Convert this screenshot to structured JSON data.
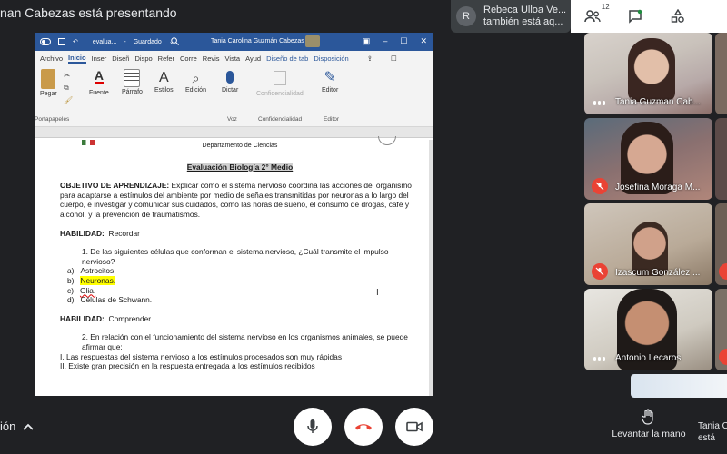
{
  "header": {
    "presenter_label": "nan Cabezas está presentando",
    "notification": {
      "initial": "R",
      "line1": "Rebeca Ulloa Ve...",
      "line2": "también está aq..."
    },
    "participant_count": "12"
  },
  "word": {
    "file_name": "evalua...",
    "save_status": "Guardado",
    "user_name": "Tania Carolina Guzmán Cabezas",
    "tabs": [
      "Archivo",
      "Inicio",
      "Inser",
      "Diseñ",
      "Dispo",
      "Refer",
      "Corre",
      "Revis",
      "Vista",
      "Ayud",
      "Diseño de tab",
      "Disposición"
    ],
    "ribbon": {
      "paste": "Pegar",
      "clipboard": "Portapapeles",
      "font": "Fuente",
      "paragraph": "Párrafo",
      "styles": "Estilos",
      "editing": "Edición",
      "dictate": "Dictar",
      "voice": "Voz",
      "confidentiality": "Confidencialidad",
      "confidentiality_group": "Confidencialidad",
      "editor": "Editor",
      "editor_group": "Editor"
    },
    "document": {
      "header_line": "Departamento de Ciencias",
      "title": "Evaluación Biología 2° Medio",
      "objective_label": "OBJETIVO DE APRENDIZAJE:",
      "objective_text": "Explicar cómo el sistema nervioso coordina las acciones del organismo para adaptarse a estímulos del ambiente por medio de señales transmitidas por neuronas a lo largo del cuerpo, e investigar y comunicar sus cuidados, como las horas de sueño, el consumo de drogas, café y alcohol, y la prevención de traumatismos.",
      "skill1_label": "HABILIDAD:",
      "skill1_value": "Recordar",
      "q1": "1.   De las siguientes células que conforman el sistema nervioso, ¿Cuál transmite el impulso nervioso?",
      "q1_options": [
        {
          "letter": "a)",
          "text": "Astrocitos."
        },
        {
          "letter": "b)",
          "text": "Neuronas."
        },
        {
          "letter": "c)",
          "text": "Glia."
        },
        {
          "letter": "d)",
          "text": "Células de Schwann."
        }
      ],
      "skill2_label": "HABILIDAD:",
      "skill2_value": "Comprender",
      "q2": "2.   En relación con el funcionamiento del sistema nervioso en los organismos animales, se puede afirmar que:",
      "statements": [
        "I. Las respuestas del sistema nervioso a los estímulos procesados son muy rápidas",
        "II. Existe gran precisión en la respuesta entregada a los estímulos recibidos"
      ]
    }
  },
  "participants": [
    {
      "name": "Tania Guzman Cab...",
      "muted": false
    },
    {
      "name": "Josefina Moraga M...",
      "muted": true
    },
    {
      "name": "Izascum González ...",
      "muted": true
    },
    {
      "name": "Antonio Lecaros",
      "muted": false
    }
  ],
  "bottom": {
    "left_label": "ión",
    "raise_hand": "Levantar la mano",
    "right_line1": "Tania C",
    "right_line2": "está"
  },
  "colors": {
    "meet_bg": "#202124",
    "word_blue": "#2b579a",
    "end_call_red": "#ea4335",
    "highlight": "#ffff00"
  }
}
